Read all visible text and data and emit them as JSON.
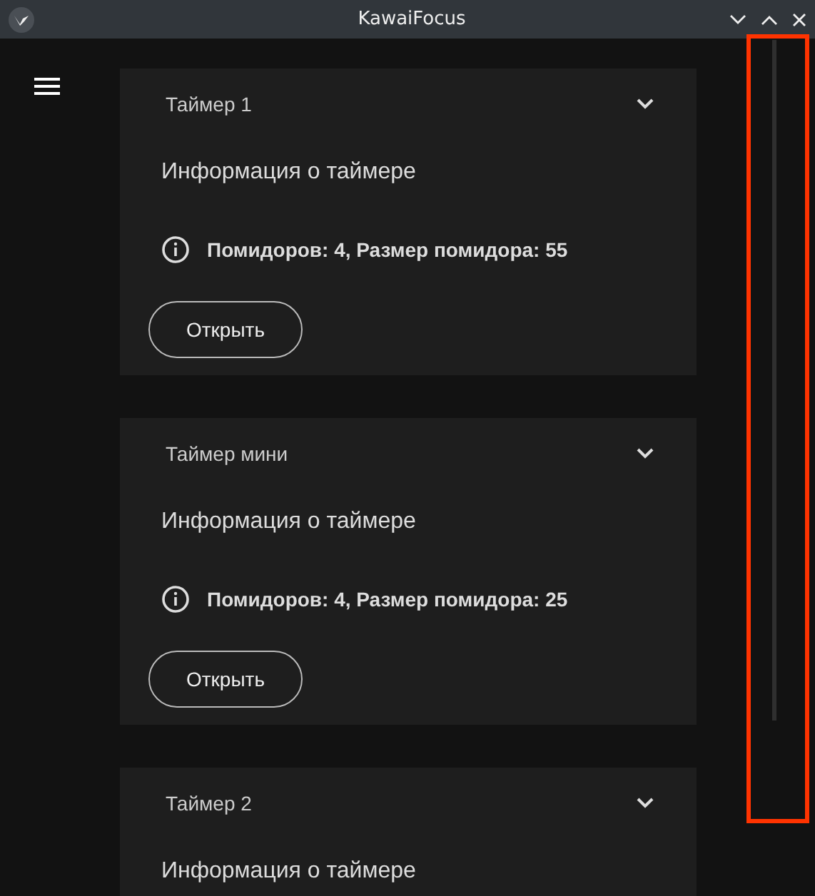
{
  "window": {
    "title": "KawaiFocus"
  },
  "timers": [
    {
      "name": "Таймер 1",
      "info_title": "Информация о таймере",
      "details": "Помидоров: 4, Размер помидора: 55",
      "button": "Открыть"
    },
    {
      "name": "Таймер мини",
      "info_title": "Информация о таймере",
      "details": "Помидоров: 4, Размер помидора: 25",
      "button": "Открыть"
    },
    {
      "name": "Таймер 2",
      "info_title": "Информация о таймере"
    }
  ]
}
